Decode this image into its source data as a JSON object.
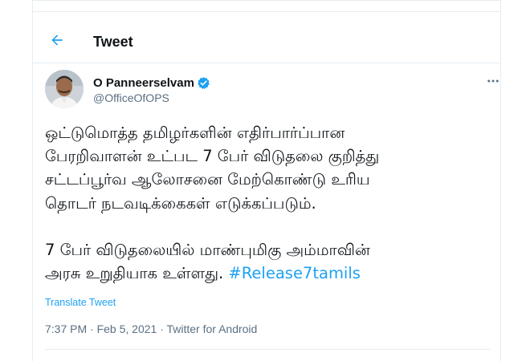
{
  "header": {
    "title": "Tweet",
    "back_icon": "arrow-left-icon"
  },
  "author": {
    "name": "O Panneerselvam",
    "handle": "@OfficeOfOPS",
    "verified_icon": "verified-badge-icon",
    "more_icon": "more-horizontal-icon"
  },
  "tweet": {
    "lines_para1": [
      "ஒட்டுமொத்த தமிழர்களின் எதிர்பார்ப்பான",
      "பேரறிவாளன் உட்பட 7 பேர் விடுதலை குறித்து",
      "சட்டப்பூர்வ ஆலோசனை மேற்கொண்டு உரிய",
      "தொடர் நடவடிக்கைகள் எடுக்கப்படும்."
    ],
    "lines_para2": [
      "7 பேர் விடுதலையில் மாண்புமிகு அம்மாவின்",
      "அரசு உறுதியாக உள்ளது. "
    ],
    "hashtag": "#Release7tamils",
    "translate_label": "Translate Tweet",
    "meta": "7:37 PM · Feb 5, 2021 · Twitter for Android"
  },
  "colors": {
    "accent": "#1da1f2",
    "text": "#0f1419",
    "muted": "#5b7083",
    "border": "#e6ecf0"
  }
}
